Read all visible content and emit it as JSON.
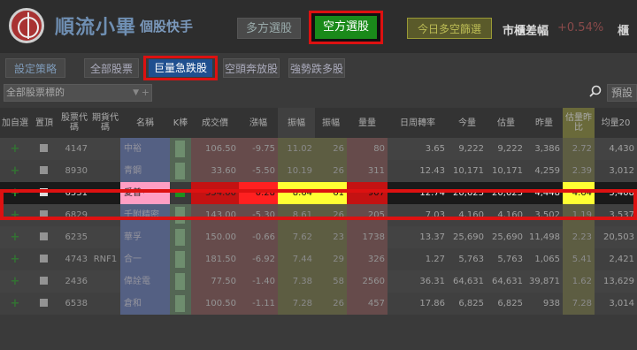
{
  "header": {
    "brand": "順流小畢",
    "brand_sub": "個股快手",
    "btn_multi": "多方選股",
    "btn_short": "空方選股",
    "btn_today": "今日多空篩選",
    "spread_label": "市櫃差幅",
    "spread_value": "+0.54%",
    "spread_more": "櫃"
  },
  "tabs": {
    "settings": "設定策略",
    "all": "全部股票",
    "volume_drop": "巨量急跌股",
    "short_release": "空頭奔放股",
    "strong_weak": "強勢跌多股"
  },
  "filter": {
    "value": "全部股票標的",
    "preset": "預設"
  },
  "columns": [
    "加自選",
    "置頂",
    "股票代碼",
    "期貨代碼",
    "名稱",
    "K棒",
    "成交價",
    "漲幅",
    "振幅",
    "振幅",
    "量量",
    "日周轉率",
    "今量",
    "估量",
    "昨量",
    "估量昨比",
    "均量20"
  ],
  "rows": [
    {
      "code": "4147",
      "fut": "",
      "name": "中裕",
      "price": "106.50",
      "chg": "-9.75",
      "amp": "11.02",
      "amp2": "26",
      "vol": "80",
      "turn": "3.65",
      "today": "9,222",
      "est": "9,222",
      "prev": "3,386",
      "ratio": "2.72",
      "avg": "4,430"
    },
    {
      "code": "8930",
      "fut": "",
      "name": "青鋼",
      "price": "33.60",
      "chg": "-5.50",
      "amp": "10.19",
      "amp2": "26",
      "vol": "311",
      "turn": "12.43",
      "today": "10,171",
      "est": "10,171",
      "prev": "4,259",
      "ratio": "2.39",
      "avg": "3,012"
    },
    {
      "code": "6531",
      "fut": "",
      "name": "愛普*",
      "price": "354.00",
      "chg": "0.28",
      "amp": "8.64",
      "amp2": "61",
      "vol": "907",
      "turn": "12.74",
      "today": "20,623",
      "est": "20,623",
      "prev": "4,448",
      "ratio": "4.64",
      "avg": "5,408"
    },
    {
      "code": "6829",
      "fut": "",
      "name": "千附精密",
      "price": "143.00",
      "chg": "-5.30",
      "amp": "8.61",
      "amp2": "26",
      "vol": "205",
      "turn": "7.03",
      "today": "4,160",
      "est": "4,160",
      "prev": "3,502",
      "ratio": "1.19",
      "avg": "3,537"
    },
    {
      "code": "6235",
      "fut": "",
      "name": "華孚",
      "price": "150.00",
      "chg": "-0.66",
      "amp": "7.62",
      "amp2": "23",
      "vol": "1738",
      "turn": "13.37",
      "today": "25,690",
      "est": "25,690",
      "prev": "11,498",
      "ratio": "2.23",
      "avg": "20,503"
    },
    {
      "code": "4743",
      "fut": "RNF1",
      "name": "合一",
      "price": "181.50",
      "chg": "-6.92",
      "amp": "7.44",
      "amp2": "29",
      "vol": "326",
      "turn": "1.27",
      "today": "5,763",
      "est": "5,763",
      "prev": "1,065",
      "ratio": "5.41",
      "avg": "2,421"
    },
    {
      "code": "2436",
      "fut": "",
      "name": "偉詮電",
      "price": "77.50",
      "chg": "-1.40",
      "amp": "7.38",
      "amp2": "58",
      "vol": "2560",
      "turn": "36.31",
      "today": "64,631",
      "est": "64,631",
      "prev": "39,871",
      "ratio": "1.62",
      "avg": "13,629"
    },
    {
      "code": "6538",
      "fut": "",
      "name": "倉和",
      "price": "100.50",
      "chg": "-1.11",
      "amp": "7.28",
      "amp2": "26",
      "vol": "457",
      "turn": "17.86",
      "today": "6,825",
      "est": "6,825",
      "prev": "938",
      "ratio": "7.28",
      "avg": "3,014"
    }
  ],
  "colors": {
    "highlight_border": "#dd1111",
    "short_btn": "#1a8a1a",
    "volume_tab": "#1f4f8f",
    "yellow": "#ffff33",
    "red": "#ff2020"
  }
}
